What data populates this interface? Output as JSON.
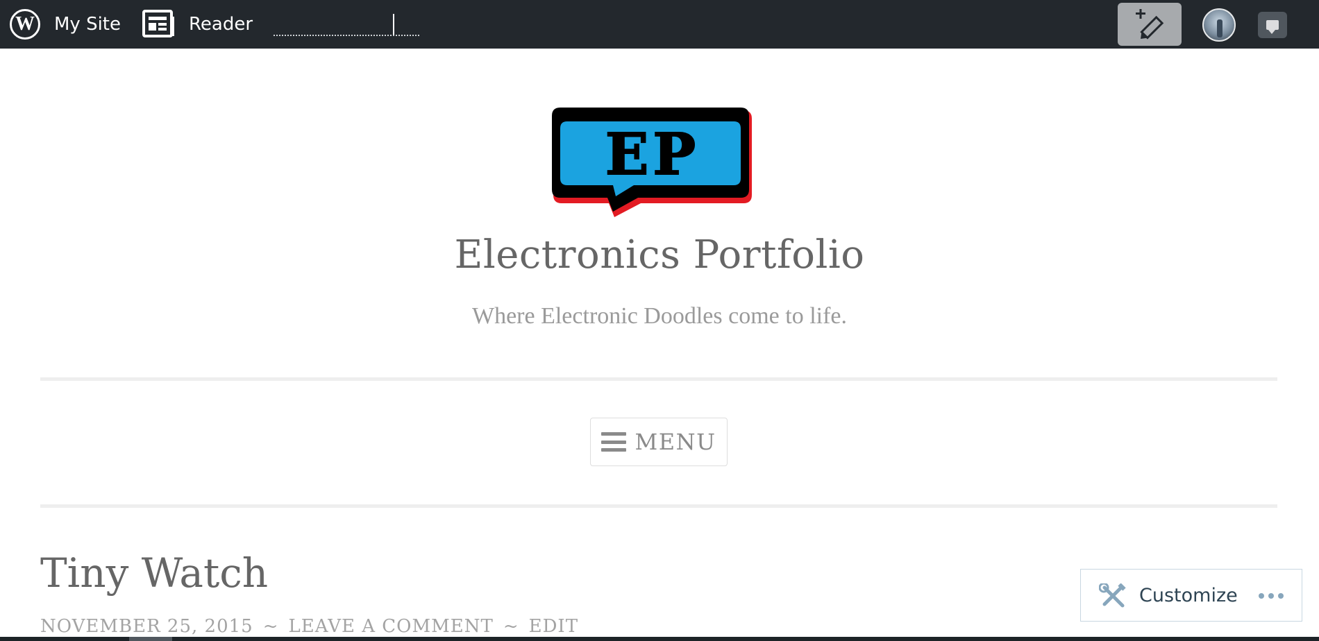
{
  "adminbar": {
    "my_site_label": "My Site",
    "reader_label": "Reader",
    "icons": {
      "wordpress": "wordpress-logo-icon",
      "reader": "reader-newspaper-icon",
      "write": "write-post-icon",
      "avatar": "user-avatar",
      "notifications": "notifications-icon"
    },
    "colors": {
      "bar": "#23282d",
      "write_button": "#a7aaad"
    }
  },
  "site": {
    "logo_text": "EP",
    "title": "Electronics Portfolio",
    "tagline": "Where Electronic Doodles come to life."
  },
  "nav": {
    "menu_label": "MENU"
  },
  "post": {
    "title": "Tiny Watch",
    "date": "NOVEMBER 25, 2015",
    "separator": "~",
    "comment_link": "LEAVE A COMMENT",
    "edit_link": "EDIT"
  },
  "customize": {
    "label": "Customize"
  }
}
